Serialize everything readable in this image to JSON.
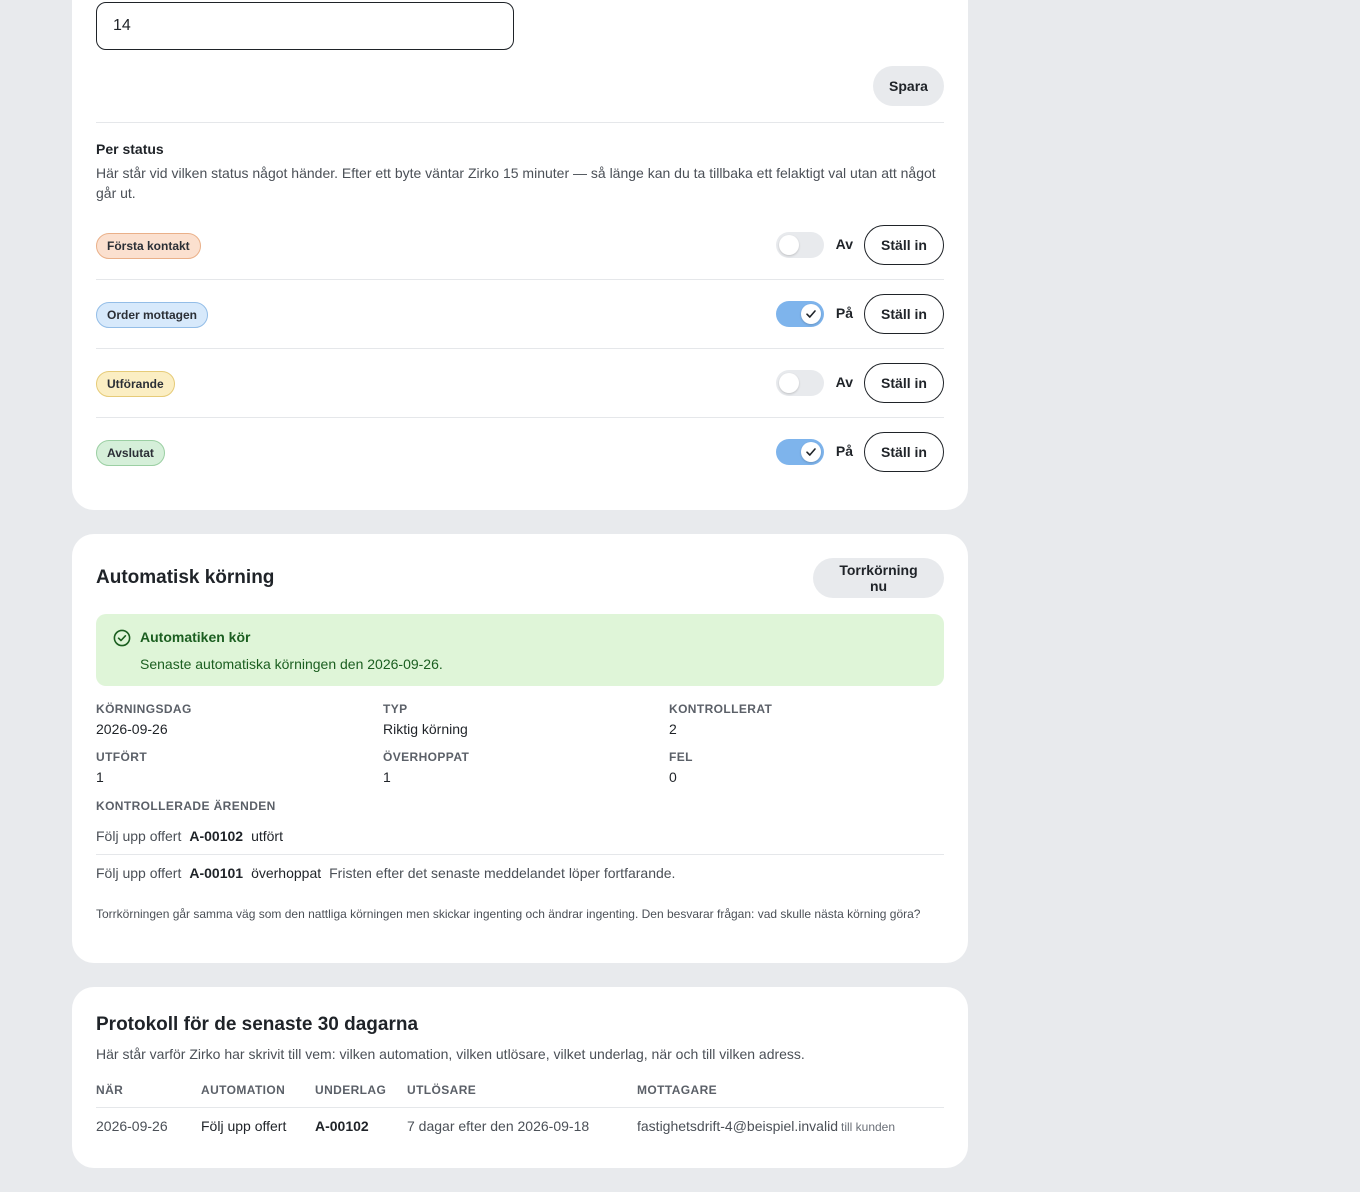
{
  "settings": {
    "days_value": "14",
    "save_label": "Spara",
    "per_status": {
      "heading": "Per status",
      "description": "Här står vid vilken status något händer. Efter ett byte väntar Zirko 15 minuter — så länge kan du ta tillbaka ett felaktigt val utan att något går ut.",
      "rows": [
        {
          "badge": "Första kontakt",
          "badge_color": "#fbe0cf",
          "enabled": false,
          "state_label": "Av",
          "button": "Ställ in"
        },
        {
          "badge": "Order mottagen",
          "badge_color": "#d7e9fb",
          "enabled": true,
          "state_label": "På",
          "button": "Ställ in"
        },
        {
          "badge": "Utförande",
          "badge_color": "#fbeec3",
          "enabled": false,
          "state_label": "Av",
          "button": "Ställ in"
        },
        {
          "badge": "Avslutat",
          "badge_color": "#d5efd9",
          "enabled": true,
          "state_label": "På",
          "button": "Ställ in"
        }
      ]
    }
  },
  "auto_run": {
    "title": "Automatisk körning",
    "dry_run_label": "Torrkörning nu",
    "alert": {
      "icon": "check-circle-icon",
      "title": "Automatiken kör",
      "text": "Senaste automatiska körningen den 2026-09-26."
    },
    "stats": [
      {
        "label": "KÖRNINGSDAG",
        "value": "2026-09-26"
      },
      {
        "label": "TYP",
        "value": "Riktig körning"
      },
      {
        "label": "KONTROLLERAT",
        "value": "2"
      },
      {
        "label": "UTFÖRT",
        "value": "1"
      },
      {
        "label": "ÖVERHOPPAT",
        "value": "1"
      },
      {
        "label": "FEL",
        "value": "0"
      }
    ],
    "checked_cases_label": "KONTROLLERADE ÄRENDEN",
    "cases": [
      {
        "automation": "Följ upp offert",
        "ref": "A-00102",
        "result": "utfört",
        "note": ""
      },
      {
        "automation": "Följ upp offert",
        "ref": "A-00101",
        "result": "överhoppat",
        "note": "Fristen efter det senaste meddelandet löper fortfarande."
      }
    ],
    "footnote": "Torrkörningen går samma väg som den nattliga körningen men skickar ingenting och ändrar ingenting. Den besvarar frågan: vad skulle nästa körning göra?"
  },
  "log": {
    "title": "Protokoll för de senaste 30 dagarna",
    "description": "Här står varför Zirko har skrivit till vem: vilken automation, vilken utlösare, vilket underlag, när och till vilken adress.",
    "columns": [
      "NÄR",
      "AUTOMATION",
      "UNDERLAG",
      "UTLÖSARE",
      "MOTTAGARE"
    ],
    "rows": [
      {
        "when": "2026-09-26",
        "automation": "Följ upp offert",
        "basis": "A-00102",
        "trigger": "7 dagar efter den 2026-09-18",
        "recipient": "fastighetsdrift-4@beispiel.invalid",
        "recipient_type": "till kunden"
      }
    ]
  },
  "colors": {
    "page_bg": "#e8eaed",
    "toggle_on": "#7eb4ec",
    "alert_bg": "#dff5d8",
    "alert_text": "#1b5e20"
  }
}
